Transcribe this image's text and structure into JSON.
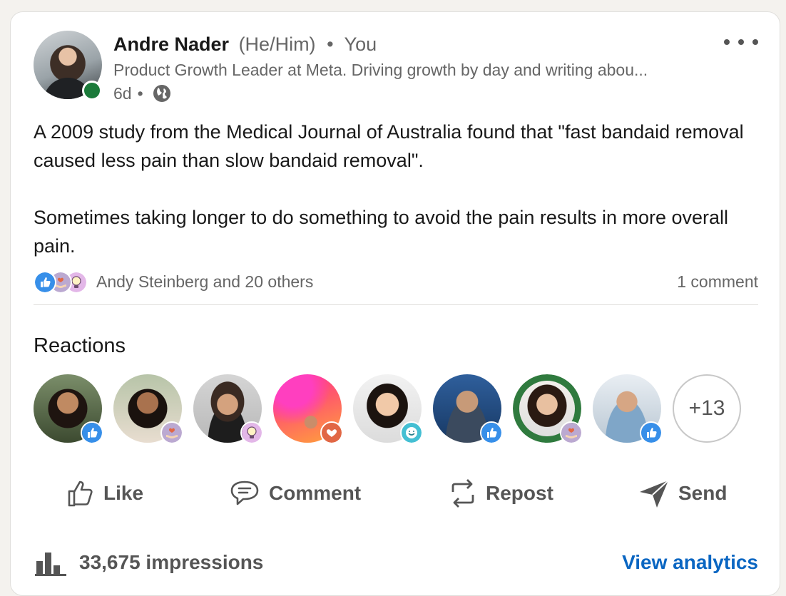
{
  "post": {
    "author_name": "Andre Nader",
    "author_pronouns": "(He/Him)",
    "separator": "•",
    "author_relation": "You",
    "headline": "Product Growth Leader at Meta. Driving growth by day and writing abou...",
    "age": "6d",
    "meta_separator": "•",
    "visibility_icon": "globe-icon",
    "paragraphs": [
      "A 2009 study from the Medical Journal of Australia found that \"fast bandaid removal caused less pain than slow bandaid removal\".",
      "Sometimes taking longer to do something to avoid the pain results in more overall pain."
    ]
  },
  "social": {
    "reaction_icons": [
      "like-reaction-icon",
      "support-reaction-icon",
      "insightful-reaction-icon"
    ],
    "reactors_summary": "Andy Steinberg and 20 others",
    "comments": "1 comment"
  },
  "reactions": {
    "title": "Reactions",
    "people": [
      {
        "reaction": "like"
      },
      {
        "reaction": "support"
      },
      {
        "reaction": "insightful"
      },
      {
        "reaction": "love"
      },
      {
        "reaction": "funny"
      },
      {
        "reaction": "like"
      },
      {
        "reaction": "support"
      },
      {
        "reaction": "like"
      }
    ],
    "more": "+13"
  },
  "actions": {
    "like": "Like",
    "comment": "Comment",
    "repost": "Repost",
    "send": "Send"
  },
  "stats": {
    "impressions": "33,675 impressions",
    "view_analytics": "View analytics"
  },
  "colors": {
    "link": "#0a66c2",
    "online": "#1b7a3a",
    "like": "#378fe9",
    "love": "#e16745",
    "support": "#bba9d1",
    "insightful": "#e3b7e8",
    "funny": "#44bfd3"
  }
}
